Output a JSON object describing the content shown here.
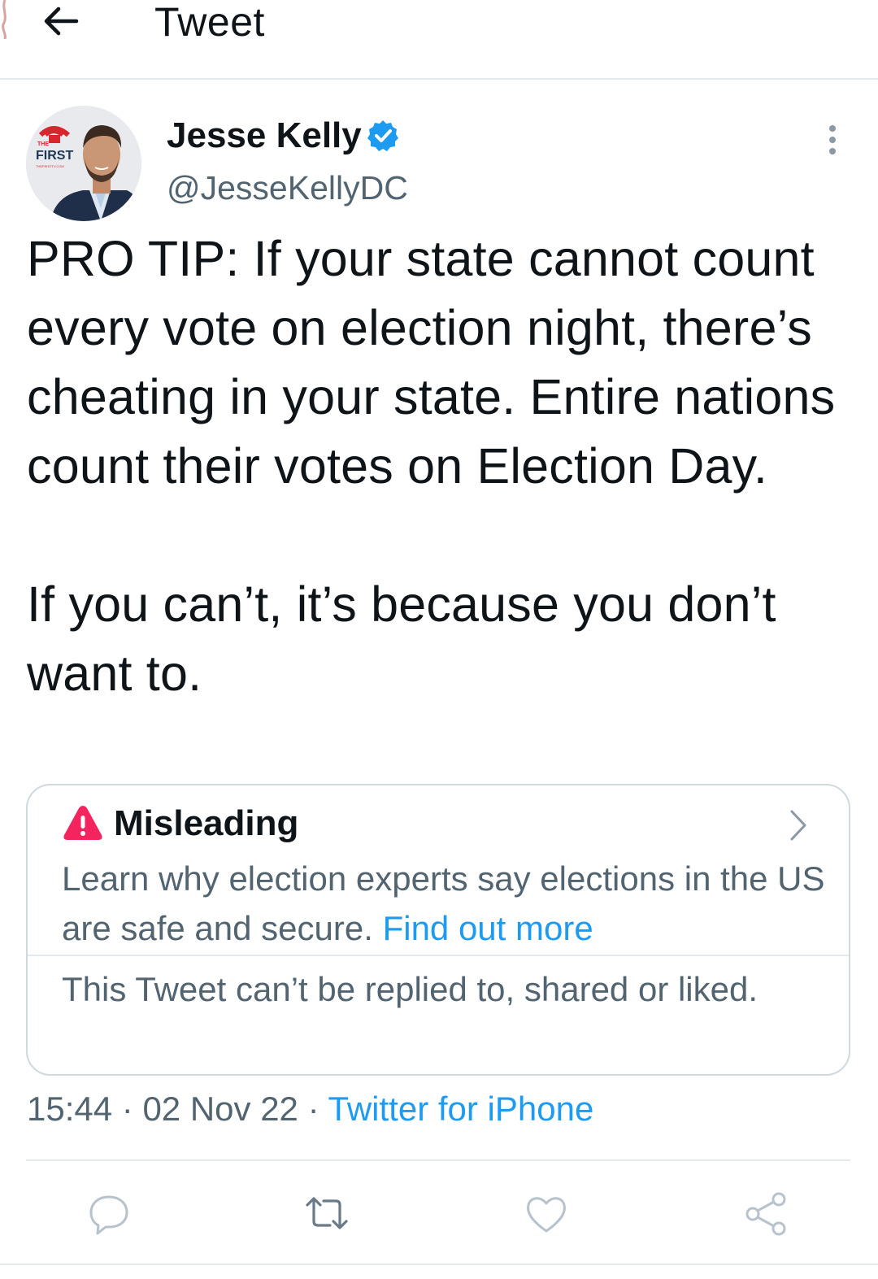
{
  "header": {
    "title": "Tweet",
    "back_icon": "arrow-left-icon"
  },
  "author": {
    "name": "Jesse Kelly",
    "handle": "@JesseKellyDC",
    "verified": true,
    "avatar_logo": {
      "line1": "THE",
      "line2": "FIRST",
      "line3": "THEFIRSTTV.COM"
    }
  },
  "tweet": {
    "paragraphs": [
      "PRO TIP: If your state cannot count every vote on election night, there’s cheating in your state. Entire nations count their votes on Election Day.",
      "If you can’t, it’s because you don’t want to."
    ]
  },
  "notice": {
    "label": "Misleading",
    "icon": "warning-icon",
    "body": "Learn why election experts say elections in the US are safe and secure.",
    "link": "Find out more",
    "restriction": "This Tweet can’t be replied to, shared or liked."
  },
  "meta": {
    "time": "15:44",
    "separator": "·",
    "date": "02 Nov 22",
    "source": "Twitter for iPhone"
  },
  "actions": [
    {
      "name": "reply",
      "icon": "reply-icon"
    },
    {
      "name": "retweet",
      "icon": "retweet-icon"
    },
    {
      "name": "like",
      "icon": "heart-icon"
    },
    {
      "name": "share",
      "icon": "share-icon"
    }
  ],
  "colors": {
    "text": "#0f1419",
    "secondary": "#536471",
    "link": "#1d9bf0",
    "warning": "#f4245e",
    "action_icon": "#8b98a5",
    "border": "#cfd9de"
  }
}
